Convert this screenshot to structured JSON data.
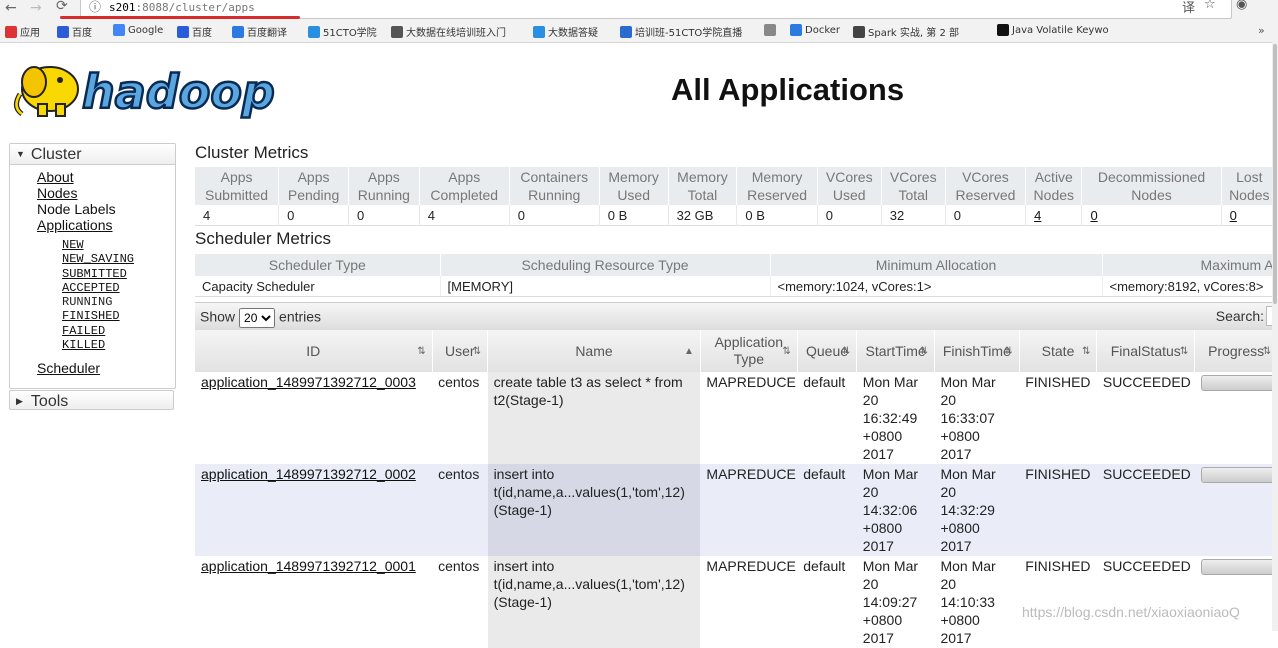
{
  "browser": {
    "url_host": "s201",
    "url_rest": ":8088/cluster/apps",
    "bookmarks": [
      {
        "label": "应用",
        "icon": "apps-grid-icon",
        "color": "#d33"
      },
      {
        "label": "百度",
        "icon": "baidu-paw-icon",
        "color": "#2a5bd8"
      },
      {
        "label": "Google",
        "icon": "google-g-icon",
        "color": "#4285f4"
      },
      {
        "label": "百度",
        "icon": "baidu-paw-icon",
        "color": "#2a5bd8"
      },
      {
        "label": "百度翻译",
        "icon": "translate-icon",
        "color": "#2a7ae2"
      },
      {
        "label": "51CTO学院",
        "icon": "51cto-icon",
        "color": "#2a8fe0"
      },
      {
        "label": "大数据在线培训班入门",
        "icon": "play-circle-icon",
        "color": "#555"
      },
      {
        "label": "大数据答疑",
        "icon": "51cto-icon",
        "color": "#2a8fe0"
      },
      {
        "label": "培训班-51CTO学院直播",
        "icon": "home-icon",
        "color": "#2a6bd0"
      },
      {
        "label": "",
        "icon": "page-icon",
        "color": "#888"
      },
      {
        "label": "Docker",
        "icon": "docker-icon",
        "color": "#2a7ae2"
      },
      {
        "label": "Spark 实战, 第 2 部",
        "icon": "spark-icon",
        "color": "#444"
      },
      {
        "label": "Java Volatile Keywo",
        "icon": "j-icon",
        "color": "#111"
      }
    ]
  },
  "page": {
    "title": "All Applications",
    "logo_text": "hadoop"
  },
  "sidebar": {
    "cluster_label": "Cluster",
    "items": [
      {
        "label": "About",
        "link": true
      },
      {
        "label": "Nodes",
        "link": true
      },
      {
        "label": "Node Labels",
        "link": false
      },
      {
        "label": "Applications",
        "link": true
      }
    ],
    "app_states": [
      "NEW",
      "NEW_SAVING",
      "SUBMITTED",
      "ACCEPTED",
      "RUNNING",
      "FINISHED",
      "FAILED",
      "KILLED"
    ],
    "scheduler_label": "Scheduler",
    "tools_label": "Tools"
  },
  "cluster_metrics": {
    "title": "Cluster Metrics",
    "headers": [
      [
        "Apps",
        "Submitted"
      ],
      [
        "Apps",
        "Pending"
      ],
      [
        "Apps",
        "Running"
      ],
      [
        "Apps",
        "Completed"
      ],
      [
        "Containers",
        "Running"
      ],
      [
        "Memory",
        "Used"
      ],
      [
        "Memory",
        "Total"
      ],
      [
        "Memory",
        "Reserved"
      ],
      [
        "VCores",
        "Used"
      ],
      [
        "VCores",
        "Total"
      ],
      [
        "VCores",
        "Reserved"
      ],
      [
        "Active",
        "Nodes"
      ],
      [
        "Decommissioned",
        "Nodes"
      ],
      [
        "Lost",
        "Nodes"
      ]
    ],
    "values": [
      "4",
      "0",
      "0",
      "4",
      "0",
      "0 B",
      "32 GB",
      "0 B",
      "0",
      "32",
      "0",
      "4",
      "0",
      "0"
    ],
    "linked": [
      11,
      12,
      13
    ]
  },
  "scheduler_metrics": {
    "title": "Scheduler Metrics",
    "headers": [
      "Scheduler Type",
      "Scheduling Resource Type",
      "Minimum Allocation",
      "Maximum Allocation"
    ],
    "values": [
      "Capacity Scheduler",
      "[MEMORY]",
      "<memory:1024, vCores:1>",
      "<memory:8192, vCores:8>"
    ]
  },
  "table_controls": {
    "show_label": "Show",
    "entries_value": "20",
    "entries_label": "entries",
    "search_label": "Search:"
  },
  "apps_table": {
    "headers": [
      "ID",
      "User",
      "Name",
      "Application Type",
      "Queue",
      "StartTime",
      "FinishTime",
      "State",
      "FinalStatus",
      "Progress"
    ],
    "rows": [
      {
        "id": "application_1489971392712_0003",
        "user": "centos",
        "name": "create table t3 as select * from t2(Stage-1)",
        "type": "MAPREDUCE",
        "queue": "default",
        "start": "Mon Mar 20 16:32:49 +0800 2017",
        "finish": "Mon Mar 20 16:33:07 +0800 2017",
        "state": "FINISHED",
        "final": "SUCCEEDED",
        "progress": 1.0
      },
      {
        "id": "application_1489971392712_0002",
        "user": "centos",
        "name": "insert into t(id,name,a...values(1,'tom',12)(Stage-1)",
        "type": "MAPREDUCE",
        "queue": "default",
        "start": "Mon Mar 20 14:32:06 +0800 2017",
        "finish": "Mon Mar 20 14:32:29 +0800 2017",
        "state": "FINISHED",
        "final": "SUCCEEDED",
        "progress": 1.0
      },
      {
        "id": "application_1489971392712_0001",
        "user": "centos",
        "name": "insert into t(id,name,a...values(1,'tom',12)(Stage-1)",
        "type": "MAPREDUCE",
        "queue": "default",
        "start": "Mon Mar 20 14:09:27 +0800 2017",
        "finish": "Mon Mar 20 14:10:33 +0800 2017",
        "state": "FINISHED",
        "final": "SUCCEEDED",
        "progress": 1.0
      }
    ]
  },
  "watermark": "https://blog.csdn.net/xiaoxiaoniaoQ"
}
